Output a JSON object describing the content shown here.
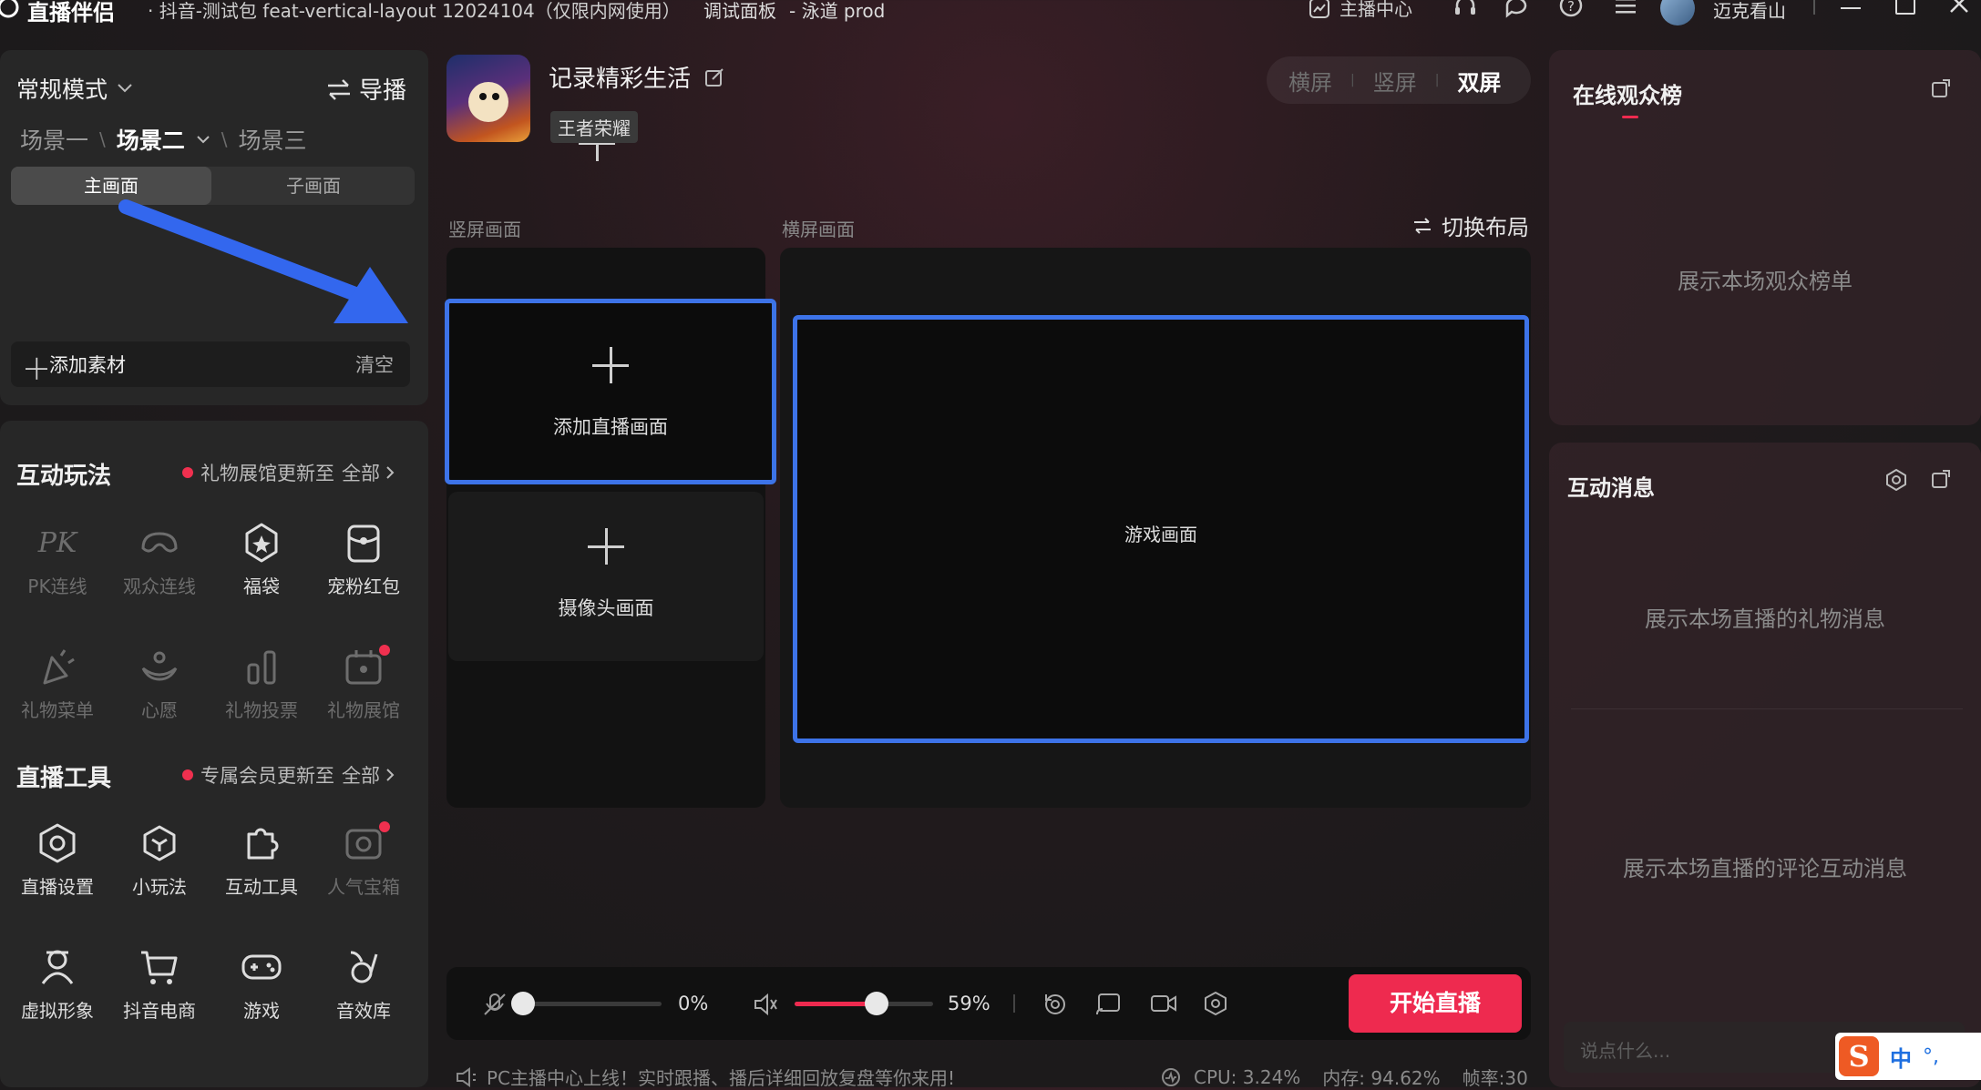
{
  "titlebar": {
    "app_name": "直播伴侣",
    "subtitle": "· 抖音-测试包 feat-vertical-layout 12024104（仅限内网使用）",
    "debug": "调试面板",
    "env": "- 泳道 prod",
    "anchor_center": "主播中心",
    "username": "迈克看山"
  },
  "scene_panel": {
    "mode": "常规模式",
    "guide": "导播",
    "scenes": [
      "场景一",
      "场景二",
      "场景三"
    ],
    "tabs": [
      "主画面",
      "子画面"
    ],
    "add_material": "添加素材",
    "clear": "清空"
  },
  "interactive": {
    "title": "互动玩法",
    "notice": "礼物展馆更新至",
    "all": "全部",
    "items": [
      "PK连线",
      "观众连线",
      "福袋",
      "宠粉红包",
      "礼物菜单",
      "心愿",
      "礼物投票",
      "礼物展馆"
    ]
  },
  "tools": {
    "title": "直播工具",
    "notice": "专属会员更新至",
    "all": "全部",
    "items": [
      "直播设置",
      "小玩法",
      "互动工具",
      "人气宝箱",
      "虚拟形象",
      "抖音电商",
      "游戏",
      "音效库"
    ]
  },
  "stream": {
    "title": "记录精彩生活",
    "tag": "王者荣耀",
    "orientation": [
      "横屏",
      "竖屏",
      "双屏"
    ],
    "vertical_label": "竖屏画面",
    "horizontal_label": "横屏画面",
    "switch_layout": "切换布局",
    "add_stream": "添加直播画面",
    "camera": "摄像头画面",
    "game": "游戏画面"
  },
  "controls": {
    "mic_percent": "0%",
    "speaker_percent": "59%",
    "mic_level": 0,
    "speaker_level": 0.59,
    "start": "开始直播"
  },
  "statusbar": {
    "notice": "PC主播中心上线！实时跟播、播后详细回放复盘等你来用!",
    "cpu": "CPU: 3.24%",
    "mem": "内存: 94.62%",
    "fps": "帧率:30"
  },
  "right": {
    "audience_title": "在线观众榜",
    "audience_placeholder": "展示本场观众榜单",
    "msg_title": "互动消息",
    "gift_placeholder": "展示本场直播的礼物消息",
    "comment_placeholder": "展示本场直播的评论互动消息",
    "input_placeholder": "说点什么...",
    "ime": "中"
  },
  "colors": {
    "accent": "#ee2a4f",
    "highlight": "#3d73e8",
    "notify": "#f0304f"
  }
}
